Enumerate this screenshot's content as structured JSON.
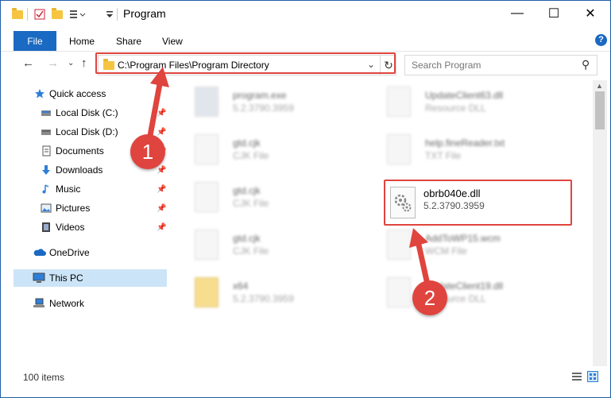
{
  "window": {
    "title": "Program",
    "minimize": "—",
    "maximize": "☐",
    "close": "✕"
  },
  "ribbon": {
    "file": "File",
    "tabs": [
      "Home",
      "Share",
      "View"
    ]
  },
  "address": {
    "path": "C:\\Program Files\\Program Directory"
  },
  "search": {
    "placeholder": "Search Program"
  },
  "sidebar": {
    "items": [
      {
        "label": "Quick access",
        "icon": "star-icon",
        "pinned": false
      },
      {
        "label": "Local Disk (C:)",
        "icon": "drive-icon",
        "pinned": true
      },
      {
        "label": "Local Disk (D:)",
        "icon": "drive-icon",
        "pinned": true
      },
      {
        "label": "Documents",
        "icon": "documents-icon",
        "pinned": true
      },
      {
        "label": "Downloads",
        "icon": "downloads-icon",
        "pinned": true
      },
      {
        "label": "Music",
        "icon": "music-icon",
        "pinned": true
      },
      {
        "label": "Pictures",
        "icon": "pictures-icon",
        "pinned": true
      },
      {
        "label": "Videos",
        "icon": "videos-icon",
        "pinned": true
      },
      {
        "label": "OneDrive",
        "icon": "cloud-icon",
        "pinned": false
      },
      {
        "label": "This PC",
        "icon": "computer-icon",
        "pinned": false,
        "selected": true
      },
      {
        "label": "Network",
        "icon": "network-icon",
        "pinned": false
      }
    ]
  },
  "files": [
    {
      "name": "program.exe",
      "sub": "5.2.3790.3959"
    },
    {
      "name": "UpdateClient63.dll",
      "sub": "Resource DLL"
    },
    {
      "name": "gtd.cjk",
      "sub": "CJK File"
    },
    {
      "name": "help.fineReader.txt",
      "sub": "TXT File"
    },
    {
      "name": "gtd.cjk",
      "sub": "CJK File"
    },
    {
      "name": "gtd.cjk",
      "sub": "CJK File"
    },
    {
      "name": "AddToWP15.wcm",
      "sub": "WCM File"
    },
    {
      "name": "x64",
      "sub": "5.2.3790.3959"
    },
    {
      "name": "UpdateClient19.dll",
      "sub": "Resource DLL"
    }
  ],
  "highlighted_file": {
    "name": "obrb040e.dll",
    "sub": "5.2.3790.3959"
  },
  "status": {
    "count": "100 items"
  },
  "callouts": [
    "1",
    "2"
  ],
  "colors": {
    "accent": "#1a69c2",
    "highlight": "#e0443e",
    "selected": "#cce4f7"
  }
}
